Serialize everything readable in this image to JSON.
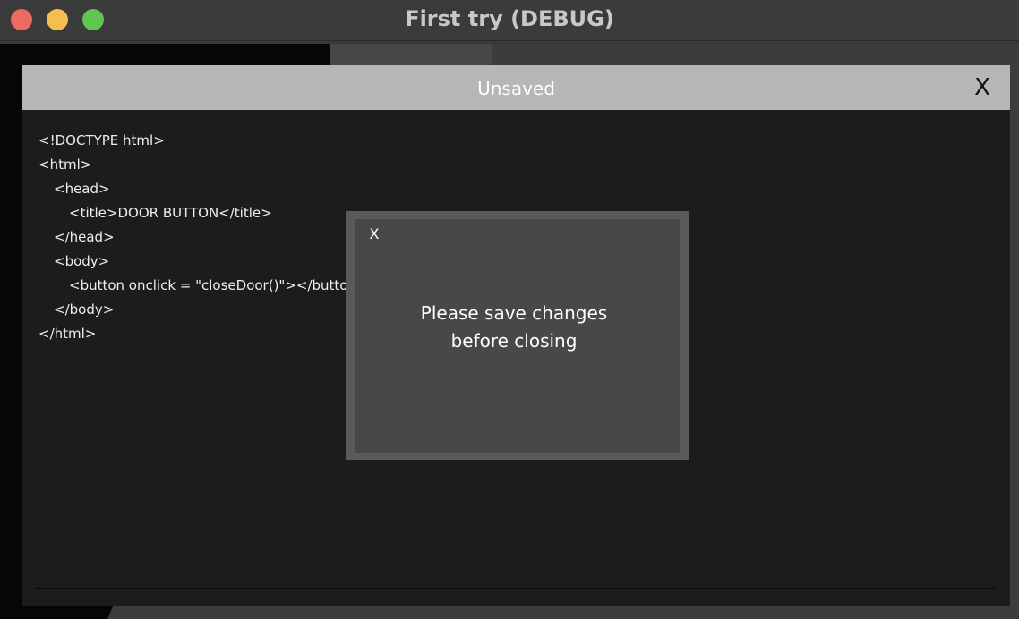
{
  "window": {
    "title": "First try (DEBUG)",
    "controls": [
      "close",
      "minimize",
      "zoom"
    ]
  },
  "editor": {
    "title": "Unsaved",
    "close_label": "X",
    "code_lines": [
      "<!DOCTYPE html>",
      "<html>",
      "<head>",
      "<title>DOOR BUTTON</title>",
      "</head>",
      "<body>",
      "<button onclick = \"closeDoor()\"></button>",
      "</body>",
      "</html>"
    ]
  },
  "dialog": {
    "close_label": "X",
    "message_line1": "Please save changes",
    "message_line2": "before closing"
  },
  "colors": {
    "close_button": "#ec6a5e",
    "minimize_button": "#f4bf4f",
    "zoom_button": "#61c554",
    "editor_header": "#b6b6b6",
    "editor_body": "#1c1c1c",
    "dialog_frame": "#5a5a5a",
    "dialog_body": "#484848"
  }
}
